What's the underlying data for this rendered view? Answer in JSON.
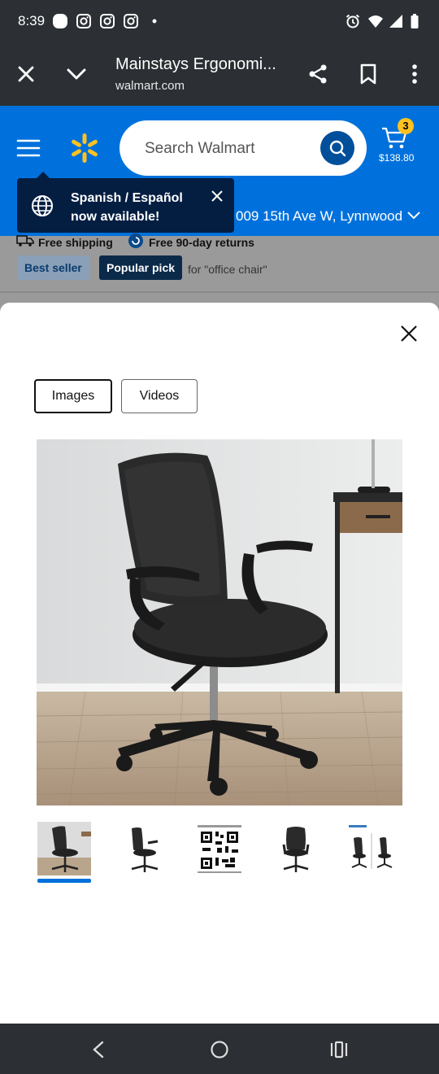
{
  "status_bar": {
    "time": "8:39",
    "left_icons": [
      "notification-dot-icon",
      "instagram-icon",
      "instagram-icon",
      "instagram-icon",
      "more-dot-icon"
    ],
    "right_icons": [
      "alarm-icon",
      "wifi-icon",
      "signal-icon",
      "battery-icon"
    ]
  },
  "browser": {
    "page_title": "Mainstays Ergonomi...",
    "url": "walmart.com",
    "icons": [
      "close-icon",
      "chevron-down-icon",
      "share-icon",
      "bookmark-icon",
      "more-vertical-icon"
    ]
  },
  "header": {
    "search_placeholder": "Search Walmart",
    "cart_count": "3",
    "cart_total": "$138.80",
    "address": "009 15th Ave W, Lynnwood",
    "brand_color": "#0071dc",
    "accent_color": "#ffc220"
  },
  "tooltip": {
    "text": "Spanish / Español now available!"
  },
  "listing_behind": {
    "free_shipping": "Free shipping",
    "free_returns": "Free 90-day returns",
    "badge_best_seller": "Best seller",
    "badge_popular_pick": "Popular pick",
    "for_text": "for \"office chair\""
  },
  "gallery": {
    "tabs": [
      {
        "label": "Images",
        "active": true
      },
      {
        "label": "Videos",
        "active": false
      }
    ],
    "main_image": "office-chair-black-mesh",
    "thumbnails": [
      "chair-in-room",
      "chair-side-view",
      "qr-instructions",
      "chair-back-view",
      "chair-dimensions"
    ],
    "selected_thumbnail_index": 0
  },
  "nav_bar": {
    "icons": [
      "back-icon",
      "home-icon",
      "recents-icon"
    ]
  }
}
